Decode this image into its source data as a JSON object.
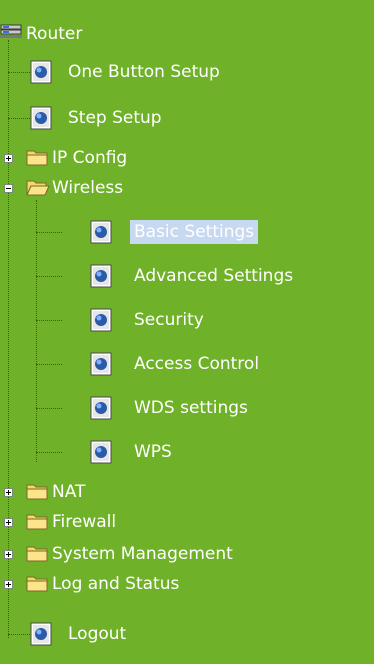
{
  "tree": {
    "root_label": "Router",
    "items": [
      {
        "label": "One Button Setup"
      },
      {
        "label": "Step Setup"
      },
      {
        "label": "IP Config"
      },
      {
        "label": "Wireless"
      }
    ],
    "wireless_children": [
      {
        "label": "Basic Settings"
      },
      {
        "label": "Advanced Settings"
      },
      {
        "label": "Security"
      },
      {
        "label": "Access Control"
      },
      {
        "label": "WDS settings"
      },
      {
        "label": "WPS"
      }
    ],
    "bottom_items": [
      {
        "label": "NAT"
      },
      {
        "label": "Firewall"
      },
      {
        "label": "System Management"
      },
      {
        "label": "Log and Status"
      },
      {
        "label": "Logout"
      }
    ]
  }
}
